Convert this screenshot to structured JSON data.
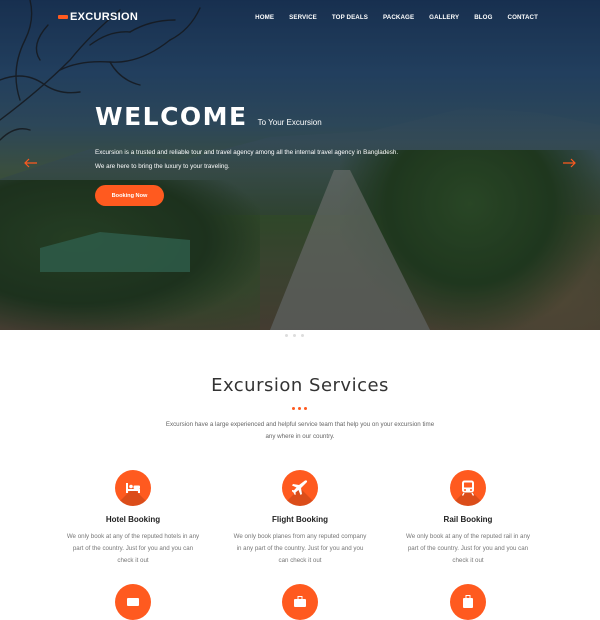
{
  "brand": {
    "name": "EXCURSION",
    "accent": "#ff5a1f"
  },
  "nav": {
    "items": [
      "HOME",
      "SERVICE",
      "TOP DEALS",
      "PACKAGE",
      "GALLERY",
      "BLOG",
      "CONTACT"
    ]
  },
  "hero": {
    "title": "WELCOME",
    "subtitle": "To Your Excursion",
    "description_line1": "Excursion is a trusted and reliable tour and travel agency among all the internal travel agency in Bangladesh.",
    "description_line2": "We are here to bring the luxury to your traveling.",
    "cta_label": "Booking Now",
    "prev_icon": "arrow-left-icon",
    "next_icon": "arrow-right-icon"
  },
  "services": {
    "title": "Excursion Services",
    "intro_line1": "Excursion have a large experienced and helpful service team that help you on your excursion time",
    "intro_line2": "any where in our country.",
    "items": [
      {
        "icon": "bed-icon",
        "title": "Hotel Booking",
        "line1": "We only book at any of the reputed hotels in any",
        "line2": "part of the country. Just for you and you can",
        "line3": "check it out"
      },
      {
        "icon": "plane-icon",
        "title": "Flight Booking",
        "line1": "We only book planes from any reputed company",
        "line2": "in any part of the country. Just for you and you",
        "line3": "can check it out"
      },
      {
        "icon": "train-icon",
        "title": "Rail Booking",
        "line1": "We only book at any of the reputed rail in any",
        "line2": "part of the country. Just for you and you can",
        "line3": "check it out"
      }
    ],
    "second_row_icons": [
      "ticket-icon",
      "bag-icon",
      "luggage-icon"
    ]
  }
}
